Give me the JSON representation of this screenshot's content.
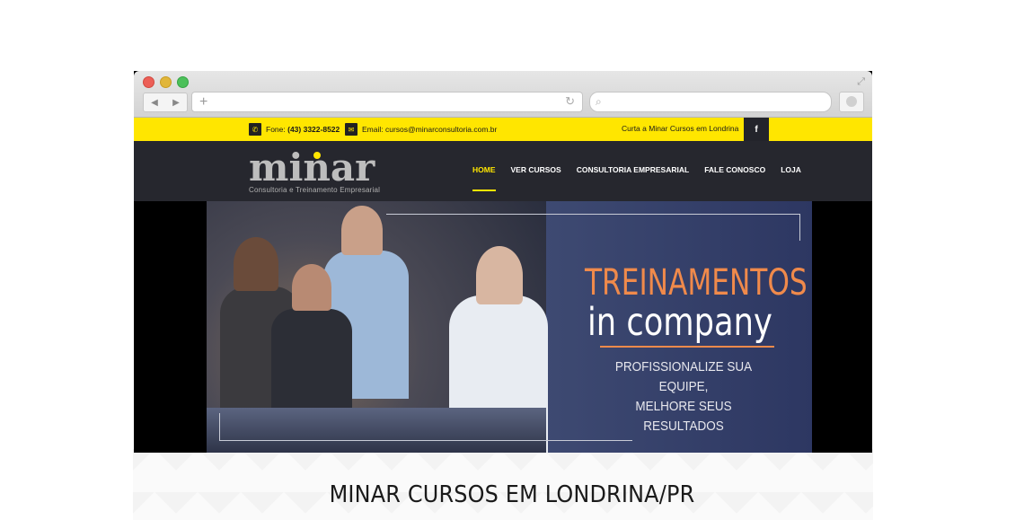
{
  "browser": {
    "window_buttons": [
      "close",
      "minimize",
      "maximize"
    ],
    "nav_icons": [
      "back-icon",
      "forward-icon"
    ],
    "address": "",
    "search": ""
  },
  "topbar": {
    "phone_label": "Fone:",
    "phone": "(43) 3322-8522",
    "email_label": "Email:",
    "email": "cursos@minarconsultoria.com.br",
    "social_text": "Curta a Minar Cursos em Londrina",
    "social_icon": "facebook-icon",
    "background": "#ffe600"
  },
  "header": {
    "logo_word": "minar",
    "logo_tagline": "Consultoria e Treinamento Empresarial",
    "nav": [
      {
        "label": "HOME",
        "active": true
      },
      {
        "label": "VER CURSOS",
        "active": false
      },
      {
        "label": "CONSULTORIA EMPRESARIAL",
        "active": false
      },
      {
        "label": "FALE CONOSCO",
        "active": false
      },
      {
        "label": "LOJA",
        "active": false
      }
    ],
    "accent": "#ffe600"
  },
  "hero": {
    "title_line1": "TREINAMENTOS",
    "title_line2": "in company",
    "subtitle_line1": "PROFISSIONALIZE SUA EQUIPE,",
    "subtitle_line2": "MELHORE SEUS RESULTADOS",
    "title_color": "#f08a4b"
  },
  "caption": "MINAR CURSOS EM LONDRINA/PR"
}
